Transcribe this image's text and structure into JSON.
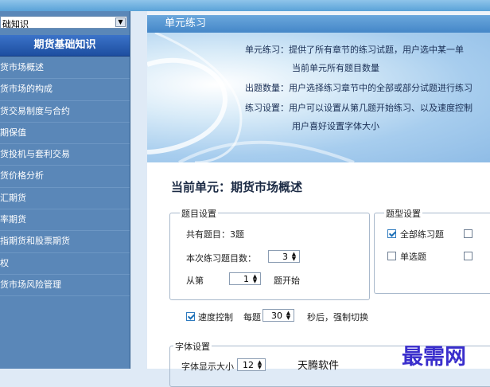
{
  "sidebar": {
    "combo_value": "础知识",
    "header": "期货基础知识",
    "items": [
      {
        "label": "货市场概述"
      },
      {
        "label": "货市场的构成"
      },
      {
        "label": "货交易制度与合约"
      },
      {
        "label": "期保值"
      },
      {
        "label": "货投机与套利交易"
      },
      {
        "label": "货价格分析"
      },
      {
        "label": "汇期货"
      },
      {
        "label": "率期货"
      },
      {
        "label": "指期货和股票期货"
      },
      {
        "label": "权"
      },
      {
        "label": "货市场风险管理"
      }
    ]
  },
  "main": {
    "title": "单元练习",
    "banner": {
      "line1": "单元练习：提供了所有章节的练习试题，用户选中某一单",
      "line2": "当前单元所有题目数量",
      "line3": "出题数量：用户选择练习章节中的全部或部分试题进行练习",
      "line4": "练习设置：用户可以设置从第几题开始练习、以及速度控制",
      "line5": "用户喜好设置字体大小"
    },
    "current_unit": "当前单元：期货市场概述",
    "question_settings": {
      "title": "题目设置",
      "total": "共有题目：3题",
      "count_label": "本次练习题目数：",
      "count_value": "3",
      "from_label": "从第",
      "from_value": "1",
      "from_suffix": "题开始"
    },
    "type_settings": {
      "title": "题型设置",
      "all_label": "全部练习题",
      "single_label": "单选题",
      "all_checked": true,
      "single_checked": false
    },
    "speed": {
      "label": "速度控制",
      "checked": true,
      "per_label": "每题",
      "seconds": "30",
      "suffix": "秒后，强制切换"
    },
    "font_settings": {
      "title": "字体设置",
      "size_label": "字体显示大小",
      "size_value": "12",
      "preview": "天腾软件"
    },
    "watermark": "最需网"
  }
}
